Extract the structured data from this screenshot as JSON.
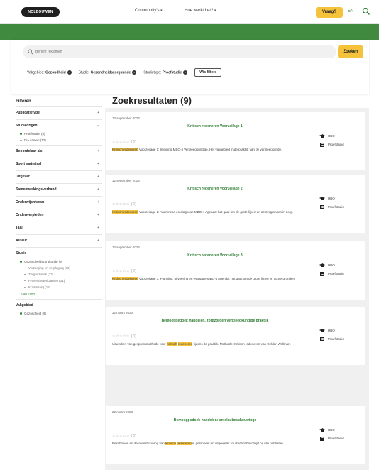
{
  "header": {
    "logo": "NOLBOUWEN",
    "nav": [
      "Community's",
      "Hoe werkt het?"
    ],
    "vraag_label": "Vraag?",
    "lang": "EN"
  },
  "search": {
    "placeholder": "Bericht reklamen",
    "button_label": "Zoeken"
  },
  "chips": [
    {
      "prefix": "Vakgebied:",
      "value": "Gezondheid"
    },
    {
      "prefix": "Studie:",
      "value": "Gezondheidszorgkunde"
    },
    {
      "prefix": "Studietype:",
      "value": "Proefstudie"
    }
  ],
  "wis_label": "Wis filters",
  "results_title": "Zoekresultaten (9)",
  "sidebar": {
    "title": "Filteren",
    "groups": [
      {
        "label": "Publicatietype",
        "toggle": "+",
        "options": []
      },
      {
        "label": "Studiedrigen",
        "toggle": "−",
        "options": [
          {
            "text": "Proefstudie (8)",
            "style": "dot"
          },
          {
            "text": "Dia samen (17)",
            "style": "dash"
          }
        ]
      },
      {
        "label": "Beoordelaar als",
        "toggle": "+",
        "options": []
      },
      {
        "label": "Soort materiaal",
        "toggle": "+",
        "options": []
      },
      {
        "label": "Uitgever",
        "toggle": "+",
        "options": []
      },
      {
        "label": "Samenwerkingsverband",
        "toggle": "+",
        "options": []
      },
      {
        "label": "Onderwijsniveau",
        "toggle": "+",
        "options": []
      },
      {
        "label": "Onderwerpleden",
        "toggle": "+",
        "options": []
      },
      {
        "label": "Taal",
        "toggle": "+",
        "options": []
      },
      {
        "label": "Auteur",
        "toggle": "+",
        "options": []
      },
      {
        "label": "Studie",
        "toggle": "−",
        "options": [
          {
            "text": "Gezondheidszorgkunde (9)",
            "style": "dot"
          },
          {
            "text": "Verzorging en verpleging (80)",
            "style": "sub"
          },
          {
            "text": "Zorgtechniek (23)",
            "style": "sub"
          },
          {
            "text": "Preventiewerkzamen (21)",
            "style": "sub"
          },
          {
            "text": "Kraamzorg (12)",
            "style": "sub"
          }
        ],
        "more": "Toon meer"
      },
      {
        "label": "Vakgebied",
        "toggle": "−",
        "options": [
          {
            "text": "Gezondheid (9)",
            "style": "dot"
          }
        ]
      }
    ]
  },
  "results": [
    {
      "date": "12 september 2023",
      "title": "Kritisch redeneren Voorzeilage 1",
      "stars": "☆☆☆☆☆ (0)",
      "hl1": "Kritisch",
      "hl2": "redeneren",
      "desc": "Voorzeilage 1: Inleiding MBO-4 Verpleegkundige. Het vakgebied in de praktijk van de verpleegkunde.",
      "level": "HBO",
      "type": "Proefstudie"
    },
    {
      "date": "12 september 2023",
      "title": "Kritisch redeneren Voorzeilage 2",
      "stars": "☆☆☆☆☆ (0)",
      "hl1": "Kritisch",
      "hl2": "redeneren",
      "desc": "Voorzeilage 2: Anamnese en diagnose MBO-4 Agenda: het gaat om de grote lijnen en achtergronden in zorg.",
      "level": "HBO",
      "type": "Proefstudie"
    },
    {
      "date": "12 september 2023",
      "title": "Kritisch redeneren Voorzeilage 3",
      "stars": "☆☆☆☆☆ (0)",
      "hl1": "Kritisch",
      "hl2": "redeneren",
      "desc": "Voorzeilage 3: Planning, uitvoering en evaluatie MBO-4 Agenda: het gaat om de grote lijnen en achtergronden.",
      "level": "HBO",
      "type": "Proefstudie"
    },
    {
      "date": "22 maart 2023",
      "title": "Bemoeppedoel: handelen, zorgzorgen verpleegkundige praktijk",
      "stars": "☆☆☆☆☆ (0)",
      "pre": "Uitwerken van gespreksmethode voor",
      "hl1": "Kritisch",
      "hl2": "redeneren",
      "desc": "tijdens de praktijk. Methode: Kritisch redeneren van Gelder-Wellman.",
      "level": "HBO",
      "type": "Proefstudie"
    },
    {
      "date": "22 maart 2023",
      "title": "Bemoeppedoel: handelen: ontslaubeschouwings",
      "stars": "☆☆☆☆☆ (0)",
      "pre": "Beschrijven en de onderbouwing van",
      "hl1": "Kritisch",
      "hl2": "redeneren",
      "desc": "in personeel en uitgewerkt tot student beschrijft bij alle patiënten.",
      "level": "HBO",
      "type": "Proefstudie"
    }
  ]
}
